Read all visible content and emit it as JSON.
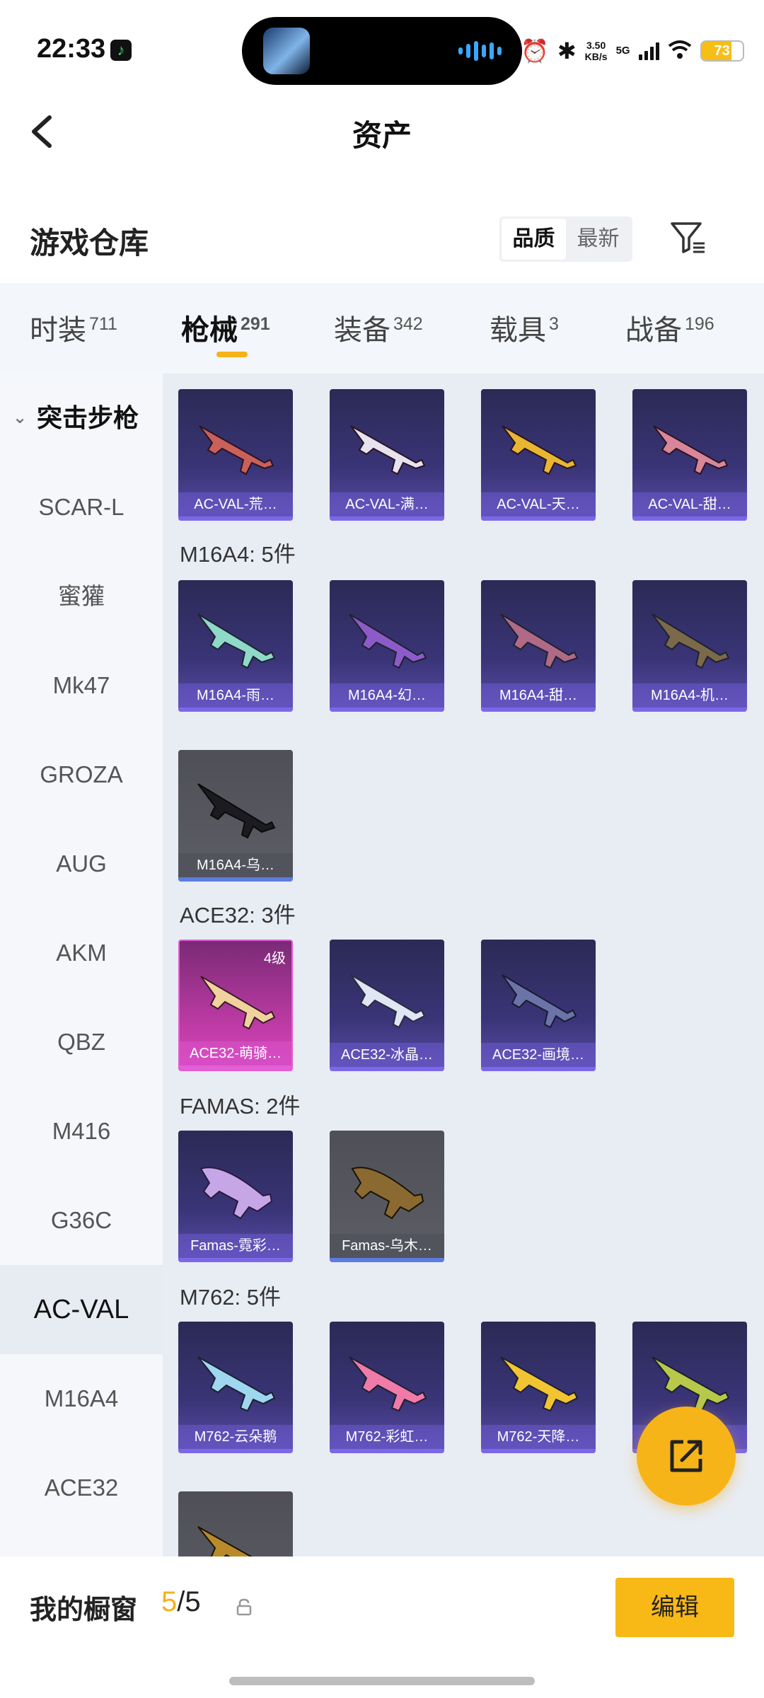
{
  "status_bar": {
    "time": "22:33",
    "app_icon": "music-note-icon",
    "net_speed_top": "3.50",
    "net_speed_bottom": "KB/s",
    "network": "5G",
    "battery": "73",
    "battery_level": 0.73,
    "battery_color": "#f6be16"
  },
  "header": {
    "title": "资产",
    "back_icon": "chevron-left-icon"
  },
  "warehouse": {
    "title": "游戏仓库",
    "sort_options": [
      "品质",
      "最新"
    ],
    "selected_sort": "品质",
    "filter_icon": "filter-icon"
  },
  "tabs": [
    {
      "label": "时装",
      "count": "711"
    },
    {
      "label": "枪械",
      "count": "291",
      "active": true
    },
    {
      "label": "装备",
      "count": "342"
    },
    {
      "label": "载具",
      "count": "3"
    },
    {
      "label": "战备",
      "count": "196"
    }
  ],
  "sidebar": {
    "group": "突击步枪",
    "items": [
      "SCAR-L",
      "蜜獾",
      "Mk47",
      "GROZA",
      "AUG",
      "AKM",
      "QBZ",
      "M416",
      "G36C",
      "AC-VAL",
      "M16A4",
      "ACE32"
    ],
    "active": "AC-VAL"
  },
  "sections": [
    {
      "title": "",
      "cards": [
        "AC-VAL-荒…",
        "AC-VAL-满…",
        "AC-VAL-天…",
        "AC-VAL-甜…"
      ]
    },
    {
      "title": "M16A4: 5件",
      "cards": [
        "M16A4-雨…",
        "M16A4-幻…",
        "M16A4-甜…",
        "M16A4-机…",
        "M16A4-乌…"
      ]
    },
    {
      "title": "ACE32: 3件",
      "cards": [
        "ACE32-萌骑…",
        "ACE32-冰晶…",
        "ACE32-画境…"
      ],
      "level_badge": "4级"
    },
    {
      "title": "FAMAS: 2件",
      "cards": [
        "Famas-霓彩…",
        "Famas-乌木…"
      ]
    },
    {
      "title": "M762: 5件",
      "cards": [
        "M762-云朵鹅",
        "M762-彩虹…",
        "M762-天降…",
        "M762-…"
      ]
    }
  ],
  "share_icon": "external-link-icon",
  "bottom_bar": {
    "label": "我的橱窗",
    "current": "5",
    "separator": "/",
    "total": "5",
    "lock_icon": "lock-icon",
    "edit_button": "编辑"
  },
  "colors": {
    "accent": "#f7b418",
    "purple_rarity": "#7b67e8",
    "pink_rarity": "#e35fd8",
    "blue_rarity": "#5c7de0"
  }
}
